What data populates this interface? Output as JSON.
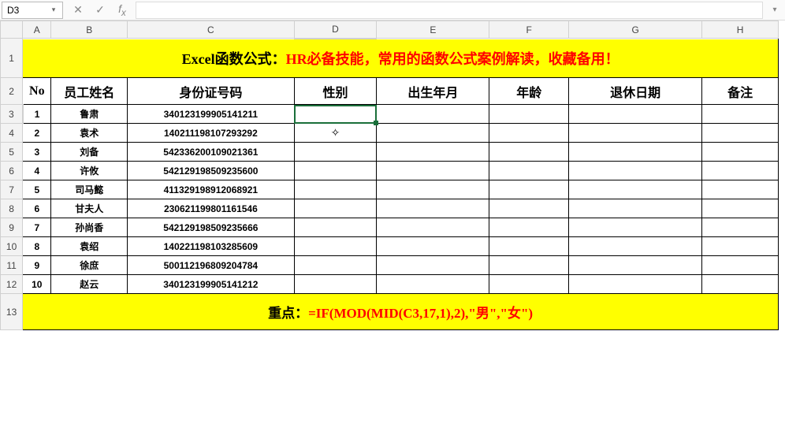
{
  "namebox": {
    "value": "D3"
  },
  "formula_bar": {
    "value": ""
  },
  "columns": [
    "A",
    "B",
    "C",
    "D",
    "E",
    "F",
    "G",
    "H"
  ],
  "row_numbers": [
    1,
    2,
    3,
    4,
    5,
    6,
    7,
    8,
    9,
    10,
    11,
    12,
    13
  ],
  "title": {
    "prefix": "Excel函数公式：",
    "red": "HR必备技能，常用的函数公式案例解读，收藏备用！"
  },
  "headers": {
    "no": "No",
    "name": "员工姓名",
    "id": "身份证号码",
    "sex": "性别",
    "dob": "出生年月",
    "age": "年龄",
    "retire": "退休日期",
    "remark": "备注"
  },
  "rows": [
    {
      "no": 1,
      "name": "鲁肃",
      "id": "340123199905141211",
      "sex": "",
      "dob": "",
      "age": "",
      "retire": "",
      "remark": ""
    },
    {
      "no": 2,
      "name": "袁术",
      "id": "140211198107293292",
      "sex": "",
      "dob": "",
      "age": "",
      "retire": "",
      "remark": ""
    },
    {
      "no": 3,
      "name": "刘备",
      "id": "542336200109021361",
      "sex": "",
      "dob": "",
      "age": "",
      "retire": "",
      "remark": ""
    },
    {
      "no": 4,
      "name": "许攸",
      "id": "542129198509235600",
      "sex": "",
      "dob": "",
      "age": "",
      "retire": "",
      "remark": ""
    },
    {
      "no": 5,
      "name": "司马懿",
      "id": "411329198912068921",
      "sex": "",
      "dob": "",
      "age": "",
      "retire": "",
      "remark": ""
    },
    {
      "no": 6,
      "name": "甘夫人",
      "id": "230621199801161546",
      "sex": "",
      "dob": "",
      "age": "",
      "retire": "",
      "remark": ""
    },
    {
      "no": 7,
      "name": "孙尚香",
      "id": "542129198509235666",
      "sex": "",
      "dob": "",
      "age": "",
      "retire": "",
      "remark": ""
    },
    {
      "no": 8,
      "name": "袁绍",
      "id": "140221198103285609",
      "sex": "",
      "dob": "",
      "age": "",
      "retire": "",
      "remark": ""
    },
    {
      "no": 9,
      "name": "徐庶",
      "id": "500112196809204784",
      "sex": "",
      "dob": "",
      "age": "",
      "retire": "",
      "remark": ""
    },
    {
      "no": 10,
      "name": "赵云",
      "id": "340123199905141212",
      "sex": "",
      "dob": "",
      "age": "",
      "retire": "",
      "remark": ""
    }
  ],
  "footer": {
    "prefix": "重点：",
    "formula": "=IF(MOD(MID(C3,17,1),2),\"男\",\"女\")"
  },
  "selection": {
    "cell": "D3",
    "col": "D",
    "row": 3
  },
  "cursor_at": "D4",
  "chart_data": {
    "type": "table",
    "title": "Excel函数公式：HR必备技能，常用的函数公式案例解读，收藏备用！",
    "columns": [
      "No",
      "员工姓名",
      "身份证号码",
      "性别",
      "出生年月",
      "年龄",
      "退休日期",
      "备注"
    ],
    "records": [
      [
        1,
        "鲁肃",
        "340123199905141211",
        "",
        "",
        "",
        "",
        ""
      ],
      [
        2,
        "袁术",
        "140211198107293292",
        "",
        "",
        "",
        "",
        ""
      ],
      [
        3,
        "刘备",
        "542336200109021361",
        "",
        "",
        "",
        "",
        ""
      ],
      [
        4,
        "许攸",
        "542129198509235600",
        "",
        "",
        "",
        "",
        ""
      ],
      [
        5,
        "司马懿",
        "411329198912068921",
        "",
        "",
        "",
        "",
        ""
      ],
      [
        6,
        "甘夫人",
        "230621199801161546",
        "",
        "",
        "",
        "",
        ""
      ],
      [
        7,
        "孙尚香",
        "542129198509235666",
        "",
        "",
        "",
        "",
        ""
      ],
      [
        8,
        "袁绍",
        "140221198103285609",
        "",
        "",
        "",
        "",
        ""
      ],
      [
        9,
        "徐庶",
        "500112196809204784",
        "",
        "",
        "",
        "",
        ""
      ],
      [
        10,
        "赵云",
        "340123199905141212",
        "",
        "",
        "",
        "",
        ""
      ]
    ],
    "note": "重点：=IF(MOD(MID(C3,17,1),2),\"男\",\"女\")"
  }
}
